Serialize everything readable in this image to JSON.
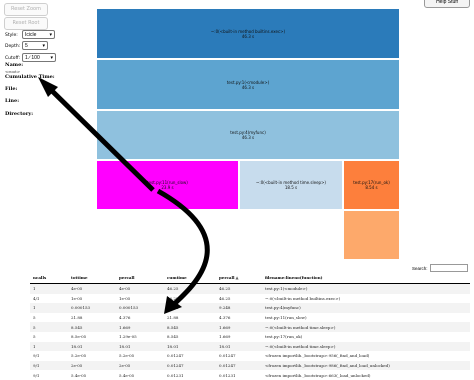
{
  "toolbar": {
    "reset_zoom": "Reset Zoom",
    "reset_root": "Reset Root",
    "help": "Help Stuff"
  },
  "controls": {
    "style_label": "Style:",
    "style_value": "Icicle",
    "depth_label": "Depth:",
    "depth_value": "5",
    "cutoff_label": "Cutoff:",
    "cutoff_value": "1 ∕ 100"
  },
  "info": {
    "name_label": "Name:",
    "name_value": "<root>",
    "cum_label": "Cumulative Time:",
    "cum_value": "",
    "file_label": "File:",
    "file_value": "",
    "line_label": "Line:",
    "line_value": "",
    "dir_label": "Directory:",
    "dir_value": ""
  },
  "colors": {
    "root": "#2b7bba",
    "level1": "#5da4d0",
    "level2": "#8fc1de",
    "magenta": "#ff00ff",
    "light": "#c7dced",
    "orange": "#fd7f3c",
    "orange_light": "#fda96b"
  },
  "blocks": {
    "b1": {
      "name": "~:0(<built-in method builtins.exec>)",
      "time": "46.3 s"
    },
    "b2": {
      "name": "test.py:1(<module>)",
      "time": "46.3 s"
    },
    "b3": {
      "name": "test.py:4(myfunc)",
      "time": "46.3 s"
    },
    "b4": {
      "name": "test.py:11(run_slow)",
      "time": "23.9 s"
    },
    "b5": {
      "name": "~:0(<built-in method time.sleep>)",
      "time": "18.5 s"
    },
    "b6": {
      "name": "test.py:17(run_ok)",
      "time": "8.54 s"
    }
  },
  "search": {
    "label": "Search:"
  },
  "table": {
    "headers": [
      "ncalls",
      "tottime",
      "percall",
      "cumtime",
      "percall",
      "filename:lineno(function)"
    ],
    "rows": [
      [
        "1",
        "4e-05",
        "4e-05",
        "46.25",
        "46.25",
        "test.py:1(<module>)"
      ],
      [
        "4/1",
        "1e-05",
        "1e-05",
        "46.25",
        "46.25",
        "~:0(<built-in method builtins.exec>)"
      ],
      [
        "1",
        "0.000153",
        "0.000153",
        "46.24",
        "9.248",
        "test.py:4(myfunc)"
      ],
      [
        "5",
        "21.88",
        "4.376",
        "21.88",
        "4.376",
        "test.py:11(run_slow)"
      ],
      [
        "5",
        "8.545",
        "1.669",
        "8.545",
        "1.669",
        "~:0(<built-in method time.sleep>)"
      ],
      [
        "5",
        "8.5e-05",
        "1.29e-05",
        "8.545",
        "1.669",
        "test.py:17(run_ok)"
      ],
      [
        "1",
        "18.01",
        "18.01",
        "18.01",
        "18.01",
        "~:0(<built-in method time.sleep>)"
      ],
      [
        "9/1",
        "5.2e-05",
        "5.2e-05",
        "0.01247",
        "0.01247",
        "<frozen importlib._bootstrap>:956(_find_and_load)"
      ],
      [
        "9/1",
        "2e-05",
        "2e-05",
        "0.01247",
        "0.01247",
        "<frozen importlib._bootstrap>:986(_find_and_load_unlocked)"
      ],
      [
        "9/1",
        "5.4e-05",
        "5.4e-05",
        "0.01231",
        "0.01231",
        "<frozen importlib._bootstrap>:663(_load_unlocked)"
      ]
    ]
  }
}
